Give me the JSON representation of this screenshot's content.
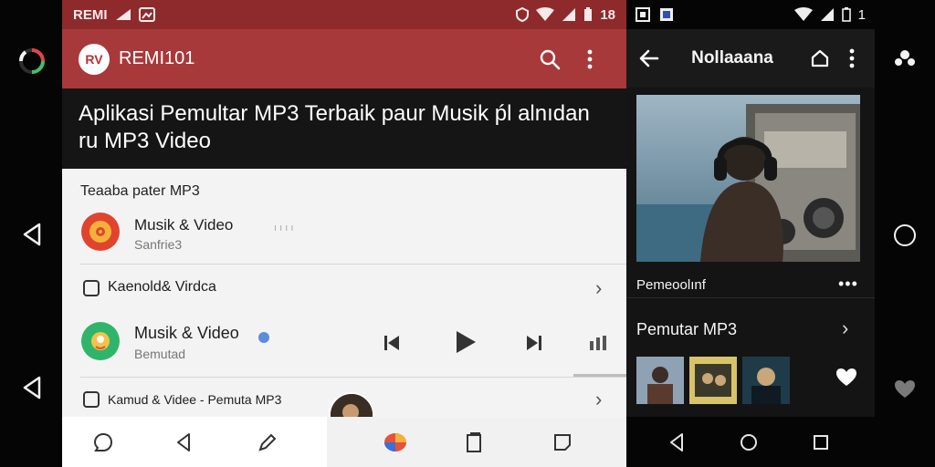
{
  "left": {
    "status_carrier": "REMI",
    "status_time": "18",
    "app_title": "REMI101",
    "app_logo": "RV",
    "headline": "Aplikasi Pemultar MP3 Terbaik paur Musik ṕl alnıdan ru MP3 Video",
    "section_title": "Teaaba pater MP3",
    "item1": {
      "title": "Musik & Video",
      "subtitle": "Sanfrie3",
      "meta": "ı ı ı ı"
    },
    "item2": {
      "title": "Kaenold& Virdca"
    },
    "item3": {
      "title": "Musik & Video",
      "subtitle": "Bemutad"
    },
    "item4": {
      "title": "Kamud & Videe - Pemuta MP3"
    }
  },
  "right": {
    "status_time": "1",
    "app_title": "Nollaaana",
    "np_title": "Pemeoolınf",
    "np_more": "•••",
    "playlist_title": "Pemutar MP3"
  },
  "colors": {
    "accent_red": "#a8393a",
    "status_red": "#8f2a2c",
    "dark_panel": "#151515",
    "right_bg": "#141414"
  },
  "icons": [
    "search-icon",
    "more-vert-icon",
    "back-arrow-icon",
    "home-icon",
    "prev-icon",
    "play-icon",
    "next-icon",
    "equalizer-icon",
    "heart-icon",
    "chevron-right-icon"
  ]
}
